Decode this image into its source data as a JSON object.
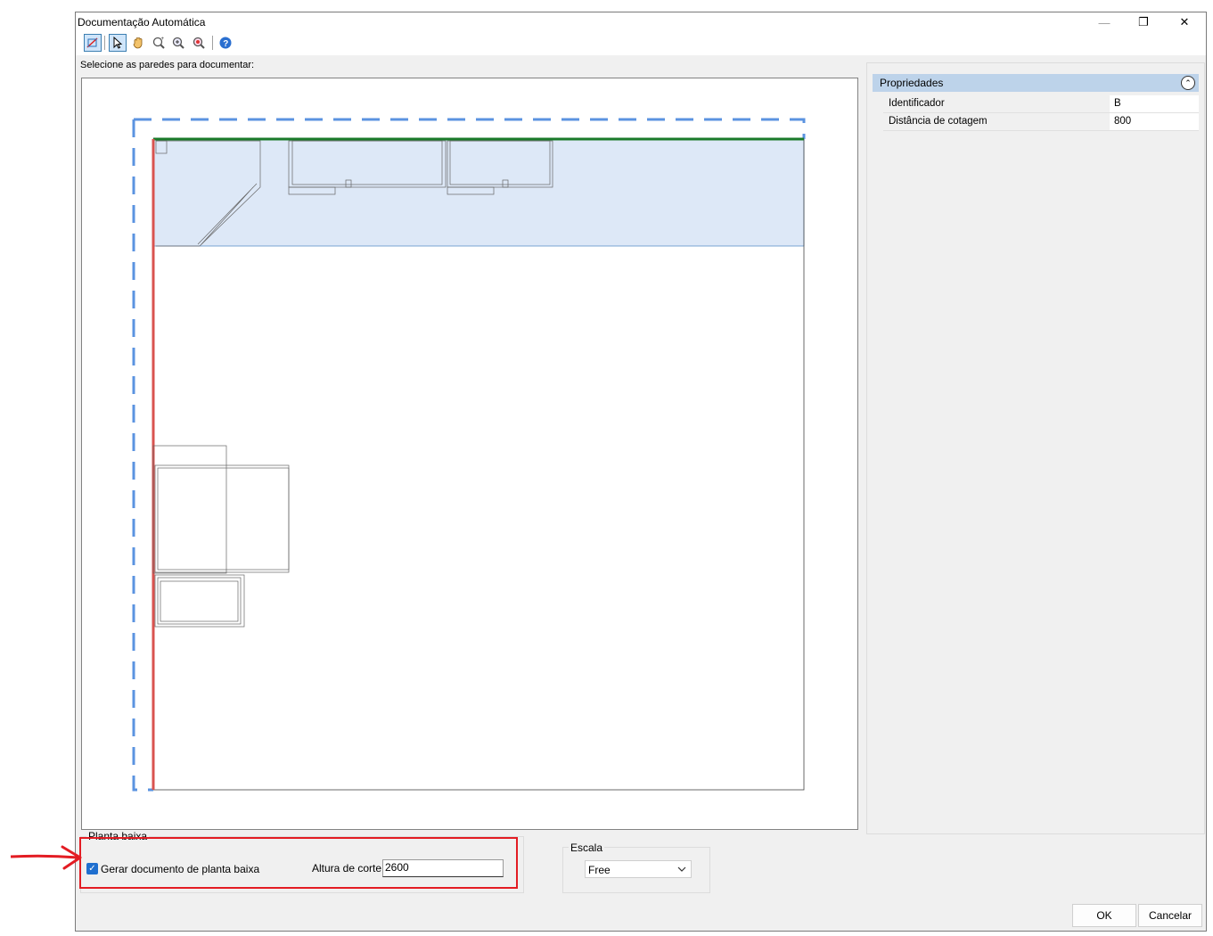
{
  "window": {
    "title": "Documentação Automática"
  },
  "titlebar": {
    "minimize": "—",
    "maximize": "❐",
    "close": "✕"
  },
  "toolbar": {
    "icons": [
      "select-walls-icon",
      "pointer-icon",
      "pan-hand-icon",
      "zoom-window-icon",
      "zoom-in-icon",
      "zoom-extents-icon",
      "help-icon"
    ]
  },
  "instruction": "Selecione as paredes para documentar:",
  "properties": {
    "header": "Propriedades",
    "rows": [
      {
        "name": "Identificador",
        "value": "B"
      },
      {
        "name": "Distância de cotagem",
        "value": "800"
      }
    ]
  },
  "floor_plan": {
    "title": "Planta baixa",
    "checkbox_label": "Gerar documento de planta baixa",
    "checked": true,
    "cut_height_label": "Altura de corte:",
    "cut_height_value": "2600"
  },
  "scale": {
    "title": "Escala",
    "selected": "Free"
  },
  "buttons": {
    "ok": "OK",
    "cancel": "Cancelar"
  },
  "colors": {
    "highlight": "#e31c23",
    "selection_dash": "#5b93e0",
    "wall_top": "#1a7a2a",
    "wall_left": "#d9534f",
    "room_fill": "#dde8f7",
    "props_header": "#bdd3ea"
  }
}
